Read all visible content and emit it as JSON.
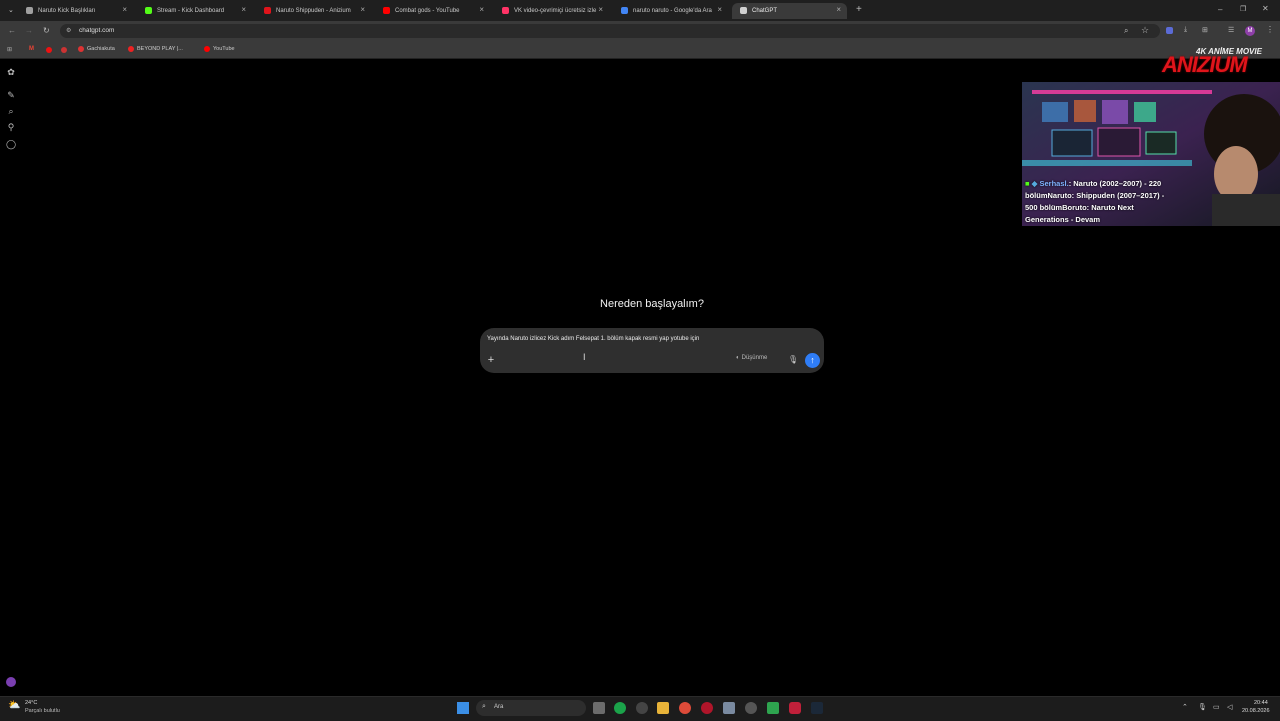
{
  "browser": {
    "tabs": [
      {
        "title": "Naruto Kick Başlıkları",
        "favicon_color": "#a0a0a0",
        "active": false
      },
      {
        "title": "Stream - Kick Dashboard",
        "favicon_color": "#53fc18",
        "active": false
      },
      {
        "title": "Naruto Shippuden - Anizium",
        "favicon_color": "#e0141b",
        "active": false
      },
      {
        "title": "Combat gods - YouTube",
        "favicon_color": "#ff0000",
        "active": false
      },
      {
        "title": "VK video-çevrimiçi ücretsiz izle",
        "favicon_color": "#ff3366",
        "active": false
      },
      {
        "title": "naruto naruto - Google'da Ara",
        "favicon_color": "#4285f4",
        "active": false
      },
      {
        "title": "ChatGPT",
        "favicon_color": "#d0d0d0",
        "active": true
      }
    ],
    "url": "chatgpt.com",
    "bookmarks": [
      {
        "label": "Gachiakuta",
        "color": "#d33"
      },
      {
        "label": "BEYOND PLAY |...",
        "color": "#e22"
      },
      {
        "label": "YouTube",
        "color": "#f00"
      }
    ]
  },
  "main": {
    "heading": "Nereden başlayalım?",
    "prompt_value": "Yayında Naruto izlicez Kick adım Felsepat 1. bölüm kapak resmi yap yotube için",
    "think_label": "Düşünme",
    "plus_symbol": "+",
    "send_symbol": "↑"
  },
  "overlay": {
    "logo_small": "4K ANİME MOVIE",
    "logo": "ANIZIUM",
    "ticker_user": "Serhasl.",
    "ticker_text": ": Naruto (2002–2007) - 220 bölümNaruto: Shippuden (2007–2017) - 500 bölümBoruto: Naruto Next Generations - Devam"
  },
  "taskbar": {
    "weather_temp": "24°C",
    "weather_desc": "Parçalı bulutlu",
    "search_placeholder": "Ara",
    "time": "20:44",
    "date": "20.08.2026"
  },
  "colors": {
    "accent_send": "#2f7df6",
    "composer_bg": "#2f2f2f",
    "overlay_red": "#e0141b"
  }
}
